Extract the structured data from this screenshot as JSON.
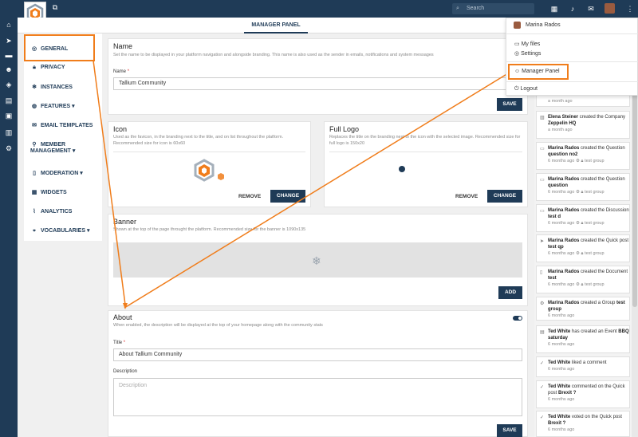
{
  "topbar": {
    "search_placeholder": "Search",
    "colors": {
      "bar": "#1f3b57",
      "accent": "#f07d1b"
    }
  },
  "tabs": {
    "active": "MANAGER PANEL"
  },
  "nav": {
    "items": [
      {
        "label": "GENERAL",
        "icon": "gauge-icon"
      },
      {
        "label": "PRIVACY",
        "icon": "lock-icon"
      },
      {
        "label": "INSTANCES",
        "icon": "snowflake-icon"
      },
      {
        "label": "FEATURES",
        "icon": "features-icon"
      },
      {
        "label": "EMAIL TEMPLATES",
        "icon": "email-icon"
      },
      {
        "label": "MEMBER",
        "label2": "MANAGEMENT",
        "icon": "member-icon"
      },
      {
        "label": "MODERATION",
        "icon": "document-icon"
      },
      {
        "label": "WIDGETS",
        "icon": "widgets-icon"
      },
      {
        "label": "ANALYTICS",
        "icon": "analytics-icon"
      },
      {
        "label": "VOCABULARIES",
        "icon": "tag-icon"
      }
    ]
  },
  "name_card": {
    "title": "Name",
    "description": "Set the name to be displayed in your platform navigation and alongside branding. This name is also used as the sender in emails, notifications and system messages",
    "field_label": "Name",
    "required": "*",
    "value": "Tallium Community",
    "save": "SAVE"
  },
  "icon_card": {
    "title": "Icon",
    "description": "Used as the favicon, in the branding next to the title, and on list throughout the platform. Recommended size for icon is 60x60",
    "remove": "REMOVE",
    "change": "CHANGE"
  },
  "logo_card": {
    "title": "Full Logo",
    "description": "Replaces the title on the branding next to the icon with the selected image. Recommended size for full logo is 150x20",
    "remove": "REMOVE",
    "change": "CHANGE"
  },
  "banner_card": {
    "title": "Banner",
    "description": "Shown at the top of the page throught the platform. Recommended size for the banner is 1090x135",
    "add": "ADD"
  },
  "about_card": {
    "title": "About",
    "description": "When enabled, the description will be displayed at the top of your homepage along with the community stats",
    "title_label": "Title",
    "required": "*",
    "title_value": "About Tallium Community",
    "desc_label": "Description",
    "desc_placeholder": "Description",
    "save": "SAVE",
    "enabled": true
  },
  "dropdown": {
    "user_name": "Marina Rados",
    "items": [
      "My files",
      "Settings",
      "Manager Panel",
      "Logout"
    ]
  },
  "feed": [
    {
      "time": "a month ago"
    },
    {
      "actor": "Elena Steiner",
      "action": "created the Company",
      "object": "Zeppelin HQ",
      "time": "a month ago"
    },
    {
      "actor": "Marina Rados",
      "action": "created the Question",
      "object": "question no2",
      "time": "6 months ago",
      "group": "test group"
    },
    {
      "actor": "Marina Rados",
      "action": "created the Question",
      "object": "question",
      "time": "6 months ago",
      "group": "test group"
    },
    {
      "actor": "Marina Rados",
      "action": "created the Discussion",
      "object": "test d",
      "time": "6 months ago",
      "group": "test group"
    },
    {
      "actor": "Marina Rados",
      "action": "created the Quick post",
      "object": "test qp",
      "time": "6 months ago",
      "group": "test group"
    },
    {
      "actor": "Marina Rados",
      "action": "created the Document",
      "object": "test",
      "time": "6 months ago",
      "group": "test group"
    },
    {
      "actor": "Marina Rados",
      "action": "created a Group",
      "object": "test group",
      "time": "6 months ago"
    },
    {
      "actor": "Ted White",
      "action": "has created an Event",
      "object": "BBQ saturday",
      "time": "6 months ago"
    },
    {
      "actor": "Ted White",
      "action": "liked a comment",
      "object": "",
      "time": "6 months ago"
    },
    {
      "actor": "Ted White",
      "action": "commented on the Quick post",
      "object": "Brexit ?",
      "time": "6 months ago"
    },
    {
      "actor": "Ted White",
      "action": "voted on the Quick post",
      "object": "Brexit ?",
      "time": "6 months ago"
    }
  ]
}
